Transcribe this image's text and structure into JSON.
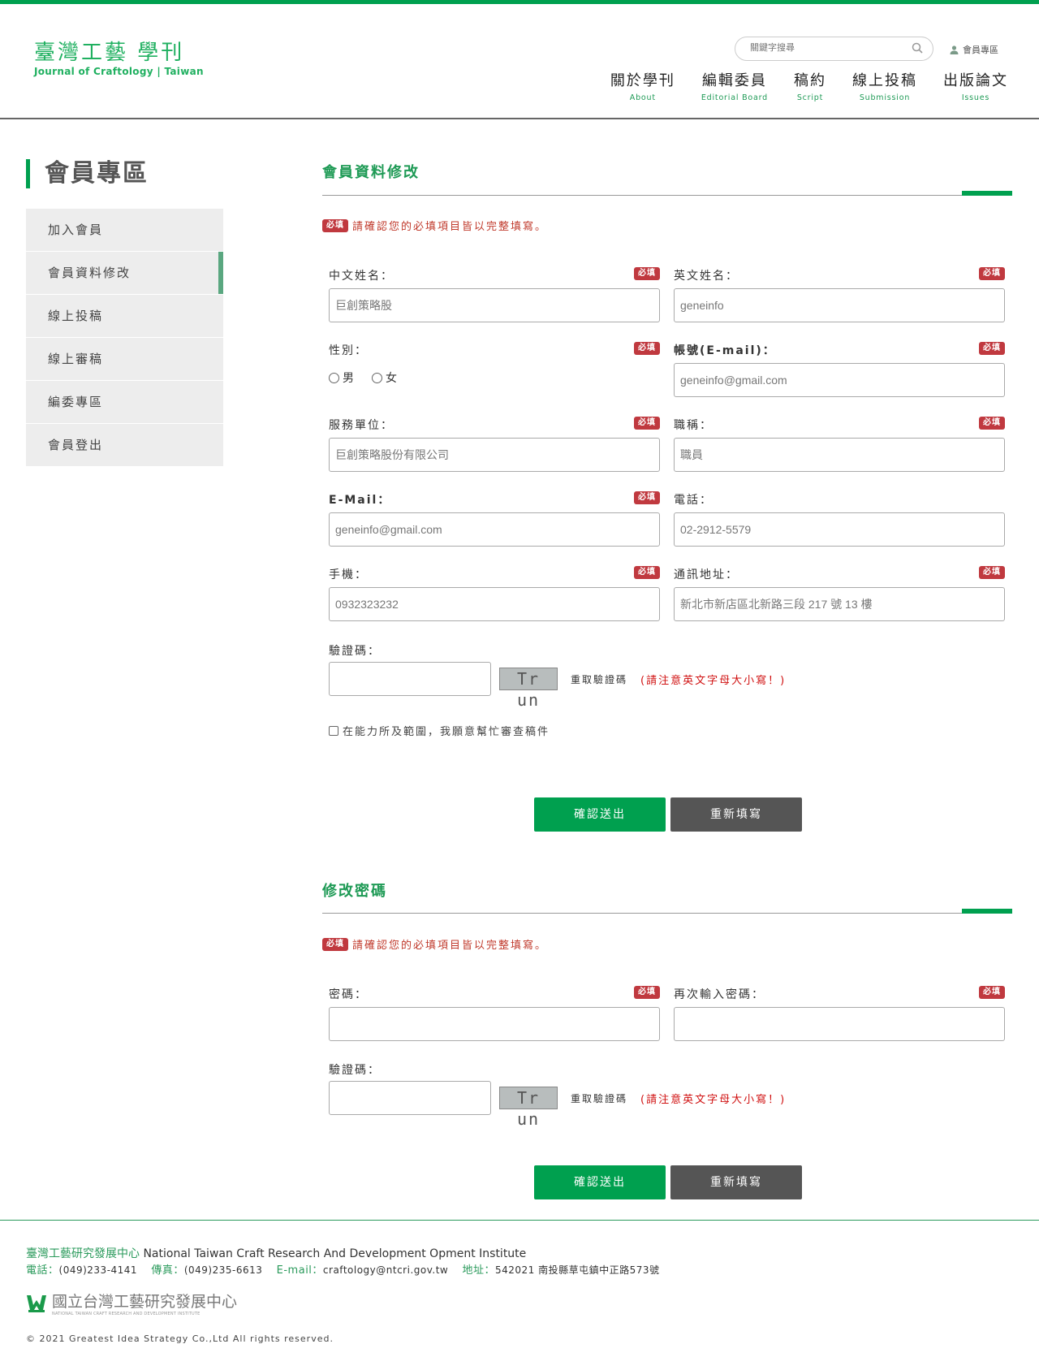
{
  "header": {
    "logo_zh": "臺灣工藝 學刊",
    "logo_en": "Journal of Craftology | Taiwan",
    "search_placeholder": "關鍵字搜尋",
    "member_link": "會員專區",
    "nav": [
      {
        "zh": "關於學刊",
        "en": "About"
      },
      {
        "zh": "編輯委員",
        "en": "Editorial Board"
      },
      {
        "zh": "稿約",
        "en": "Script"
      },
      {
        "zh": "線上投稿",
        "en": "Submission"
      },
      {
        "zh": "出版論文",
        "en": "Issues"
      }
    ]
  },
  "sidebar": {
    "title": "會員專區",
    "items": [
      {
        "label": "加入會員"
      },
      {
        "label": "會員資料修改",
        "active": true
      },
      {
        "label": "線上投稿"
      },
      {
        "label": "線上審稿"
      },
      {
        "label": "編委專區"
      },
      {
        "label": "會員登出"
      }
    ]
  },
  "required_badge": "必填",
  "notice": "請確認您的必填項目皆以完整填寫。",
  "profile": {
    "title": "會員資料修改",
    "fields": {
      "name_zh": {
        "label": "中文姓名：",
        "value": "巨創策略股"
      },
      "name_en": {
        "label": "英文姓名：",
        "value": "geneinfo"
      },
      "gender": {
        "label": "性別：",
        "options": [
          "男",
          "女"
        ]
      },
      "account": {
        "label": "帳號(E-mail)：",
        "value": "geneinfo@gmail.com"
      },
      "org": {
        "label": "服務單位：",
        "value": "巨創策略股份有限公司"
      },
      "job": {
        "label": "職稱：",
        "value": "職員"
      },
      "email": {
        "label": "E-Mail：",
        "value": "geneinfo@gmail.com"
      },
      "phone": {
        "label": "電話：",
        "value": "02-2912-5579"
      },
      "mobile": {
        "label": "手機：",
        "value": "0932323232"
      },
      "address": {
        "label": "通訊地址：",
        "value": "新北市新店區北新路三段 217 號 13 樓"
      }
    },
    "captcha_label": "驗證碼：",
    "captcha_text": "Tr un",
    "refresh": "重取驗證碼",
    "caution": "(請注意英文字母大小寫！)",
    "agree": "在能力所及範圍，我願意幫忙審查稿件",
    "submit": "確認送出",
    "reset": "重新填寫"
  },
  "password": {
    "title": "修改密碼",
    "pw_label": "密碼：",
    "pw2_label": "再次輸入密碼：",
    "captcha_label": "驗證碼：",
    "captcha_text": "Tr un",
    "refresh": "重取驗證碼",
    "caution": "(請注意英文字母大小寫！)",
    "submit": "確認送出",
    "reset": "重新填寫"
  },
  "footer": {
    "org_zh": "臺灣工藝研究發展中心",
    "org_en": " National Taiwan Craft Research And Development Opment Institute",
    "tel_label": "電話：",
    "tel": "(049)233-4141",
    "fax_label": "傳真：",
    "fax": "(049)235-6613",
    "email_label": "E-mail：",
    "email": "craftology@ntcri.gov.tw",
    "addr_label": "地址：",
    "addr": "542021 南投縣草屯鎮中正路573號",
    "logo_zh": "國立台灣工藝研究發展中心",
    "logo_en": "NATIONAL TAIWAN CRAFT RESEARCH AND DEVELOPMENT INSTITUTE",
    "copyright": "© 2021 Greatest Idea Strategy Co.,Ltd All rights reserved."
  },
  "colors": {
    "brand": "#00a04f",
    "required": "#c0393f",
    "reset": "#555555"
  }
}
